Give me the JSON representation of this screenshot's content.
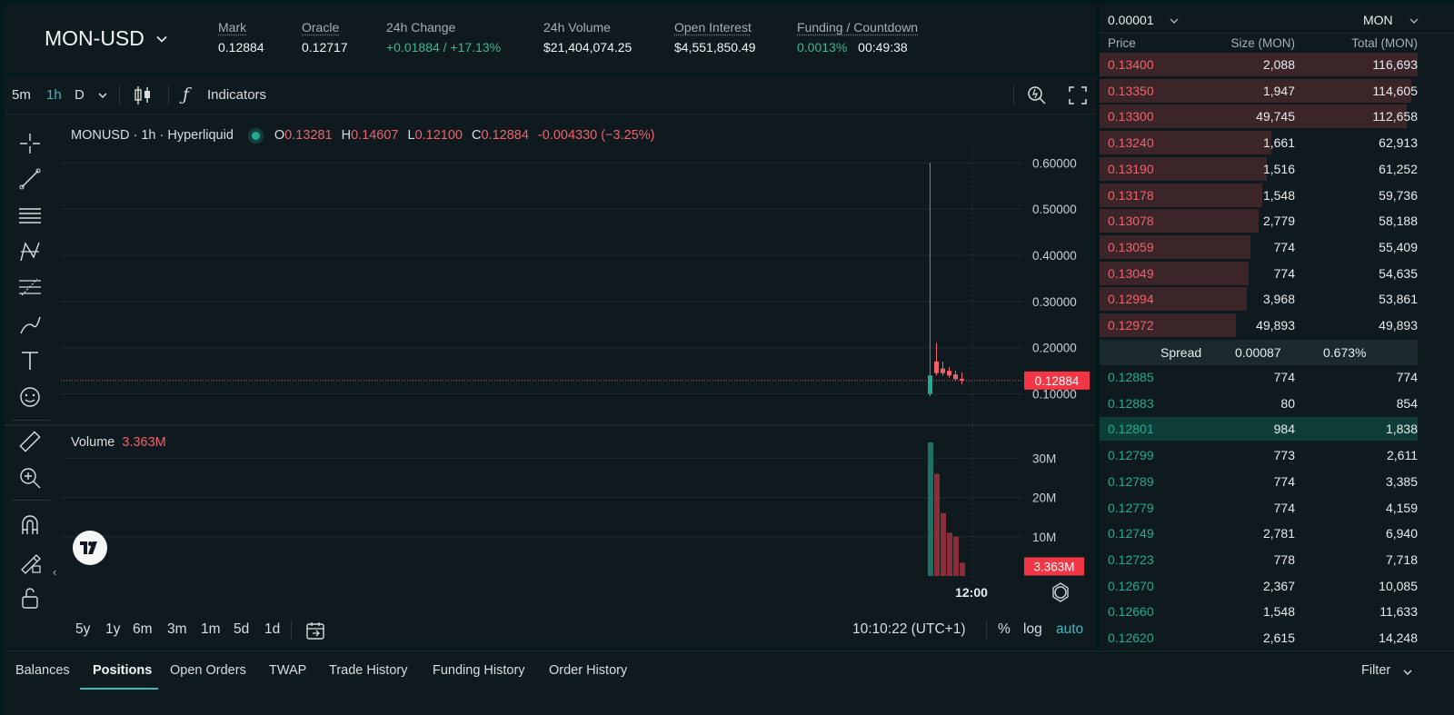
{
  "header": {
    "symbol": "MON-USD",
    "stats": [
      {
        "label": "Mark",
        "value": "0.12884",
        "underline": true
      },
      {
        "label": "Oracle",
        "value": "0.12717",
        "underline": true
      },
      {
        "label": "24h Change",
        "value": "+0.01884 / +17.13%",
        "underline": false
      },
      {
        "label": "24h Volume",
        "value": "$21,404,074.25",
        "underline": false
      },
      {
        "label": "Open Interest",
        "value": "$4,551,850.49",
        "underline": true
      }
    ],
    "funding": {
      "label": "Funding / Countdown",
      "rate": "0.0013%",
      "countdown": "00:49:38"
    }
  },
  "toolbar": {
    "intervals": [
      "5m",
      "1h",
      "D"
    ],
    "active_interval": "1h",
    "indicators_label": "Indicators"
  },
  "legend": {
    "title": "MONUSD · 1h · Hyperliquid",
    "o_label": "O",
    "o": "0.13281",
    "h_label": "H",
    "h": "0.14607",
    "l_label": "L",
    "l": "0.12100",
    "c_label": "C",
    "c": "0.12884",
    "change": "-0.004330 (−3.25%)"
  },
  "volume_legend": {
    "label": "Volume",
    "value": "3.363M"
  },
  "price_axis": {
    "ticks": [
      "0.60000",
      "0.50000",
      "0.40000",
      "0.30000",
      "0.20000",
      "0.10000"
    ],
    "tick_values": [
      0.6,
      0.5,
      0.4,
      0.3,
      0.2,
      0.1
    ],
    "last_price": "0.12884",
    "last_price_value": 0.12884
  },
  "volume_axis": {
    "ticks": [
      "30M",
      "20M",
      "10M"
    ],
    "tick_values": [
      30,
      20,
      10
    ],
    "last_volume": "3.363M",
    "last_volume_value": 3.363
  },
  "time_axis": {
    "label": "12:00"
  },
  "chart_data": {
    "type": "candlestick",
    "candles": [
      {
        "o": 0.1,
        "h": 0.6,
        "l": 0.095,
        "c": 0.14,
        "dir": "up"
      },
      {
        "o": 0.17,
        "h": 0.21,
        "l": 0.14,
        "c": 0.145,
        "dir": "down"
      },
      {
        "o": 0.155,
        "h": 0.17,
        "l": 0.14,
        "c": 0.145,
        "dir": "down"
      },
      {
        "o": 0.15,
        "h": 0.158,
        "l": 0.135,
        "c": 0.14,
        "dir": "down"
      },
      {
        "o": 0.142,
        "h": 0.15,
        "l": 0.128,
        "c": 0.132,
        "dir": "down"
      },
      {
        "o": 0.1328,
        "h": 0.1461,
        "l": 0.121,
        "c": 0.1288,
        "dir": "down"
      }
    ],
    "volumes": [
      {
        "v": 34,
        "dir": "up"
      },
      {
        "v": 26,
        "dir": "down"
      },
      {
        "v": 16,
        "dir": "down"
      },
      {
        "v": 11,
        "dir": "down"
      },
      {
        "v": 10,
        "dir": "down"
      },
      {
        "v": 3.363,
        "dir": "down"
      }
    ],
    "price_range": [
      0.05,
      0.63
    ],
    "volume_range": [
      0,
      37
    ]
  },
  "range_buttons": [
    "5y",
    "1y",
    "6m",
    "3m",
    "1m",
    "5d",
    "1d"
  ],
  "clock": "10:10:22 (UTC+1)",
  "scale_buttons": {
    "percent": "%",
    "log": "log",
    "auto": "auto"
  },
  "orderbook": {
    "tick_size": "0.00001",
    "unit": "MON",
    "columns": {
      "price": "Price",
      "size": "Size (MON)",
      "total": "Total (MON)"
    },
    "asks": [
      {
        "price": "0.13400",
        "size": "2,088",
        "total": "116,693",
        "depth": 1.0
      },
      {
        "price": "0.13350",
        "size": "1,947",
        "total": "114,605",
        "depth": 0.98
      },
      {
        "price": "0.13300",
        "size": "49,745",
        "total": "112,658",
        "depth": 0.965
      },
      {
        "price": "0.13240",
        "size": "1,661",
        "total": "62,913",
        "depth": 0.54
      },
      {
        "price": "0.13190",
        "size": "1,516",
        "total": "61,252",
        "depth": 0.525
      },
      {
        "price": "0.13178",
        "size": "1,548",
        "total": "59,736",
        "depth": 0.512
      },
      {
        "price": "0.13078",
        "size": "2,779",
        "total": "58,188",
        "depth": 0.499
      },
      {
        "price": "0.13059",
        "size": "774",
        "total": "55,409",
        "depth": 0.475
      },
      {
        "price": "0.13049",
        "size": "774",
        "total": "54,635",
        "depth": 0.468
      },
      {
        "price": "0.12994",
        "size": "3,968",
        "total": "53,861",
        "depth": 0.462
      },
      {
        "price": "0.12972",
        "size": "49,893",
        "total": "49,893",
        "depth": 0.428
      }
    ],
    "spread": {
      "label": "Spread",
      "value": "0.00087",
      "percent": "0.673%"
    },
    "bids": [
      {
        "price": "0.12885",
        "size": "774",
        "total": "774",
        "depth": 0.0
      },
      {
        "price": "0.12883",
        "size": "80",
        "total": "854",
        "depth": 0.0
      },
      {
        "price": "0.12801",
        "size": "984",
        "total": "1,838",
        "depth": 0.0,
        "highlight": true
      },
      {
        "price": "0.12799",
        "size": "773",
        "total": "2,611",
        "depth": 0.0
      },
      {
        "price": "0.12789",
        "size": "774",
        "total": "3,385",
        "depth": 0.0
      },
      {
        "price": "0.12779",
        "size": "774",
        "total": "4,159",
        "depth": 0.0
      },
      {
        "price": "0.12749",
        "size": "2,781",
        "total": "6,940",
        "depth": 0.0
      },
      {
        "price": "0.12723",
        "size": "778",
        "total": "7,718",
        "depth": 0.0
      },
      {
        "price": "0.12670",
        "size": "2,367",
        "total": "10,085",
        "depth": 0.0
      },
      {
        "price": "0.12660",
        "size": "1,548",
        "total": "11,633",
        "depth": 0.0
      },
      {
        "price": "0.12620",
        "size": "2,615",
        "total": "14,248",
        "depth": 0.0
      }
    ]
  },
  "bottom_tabs": [
    "Balances",
    "Positions",
    "Open Orders",
    "TWAP",
    "Trade History",
    "Funding History",
    "Order History"
  ],
  "active_tab": "Positions",
  "filter_label": "Filter",
  "colors": {
    "up": "#22ab94",
    "down": "#f0616d",
    "accent": "#3fb6c2",
    "ask_bar": "#3b2528",
    "bid_highlight": "#0f3d38"
  }
}
